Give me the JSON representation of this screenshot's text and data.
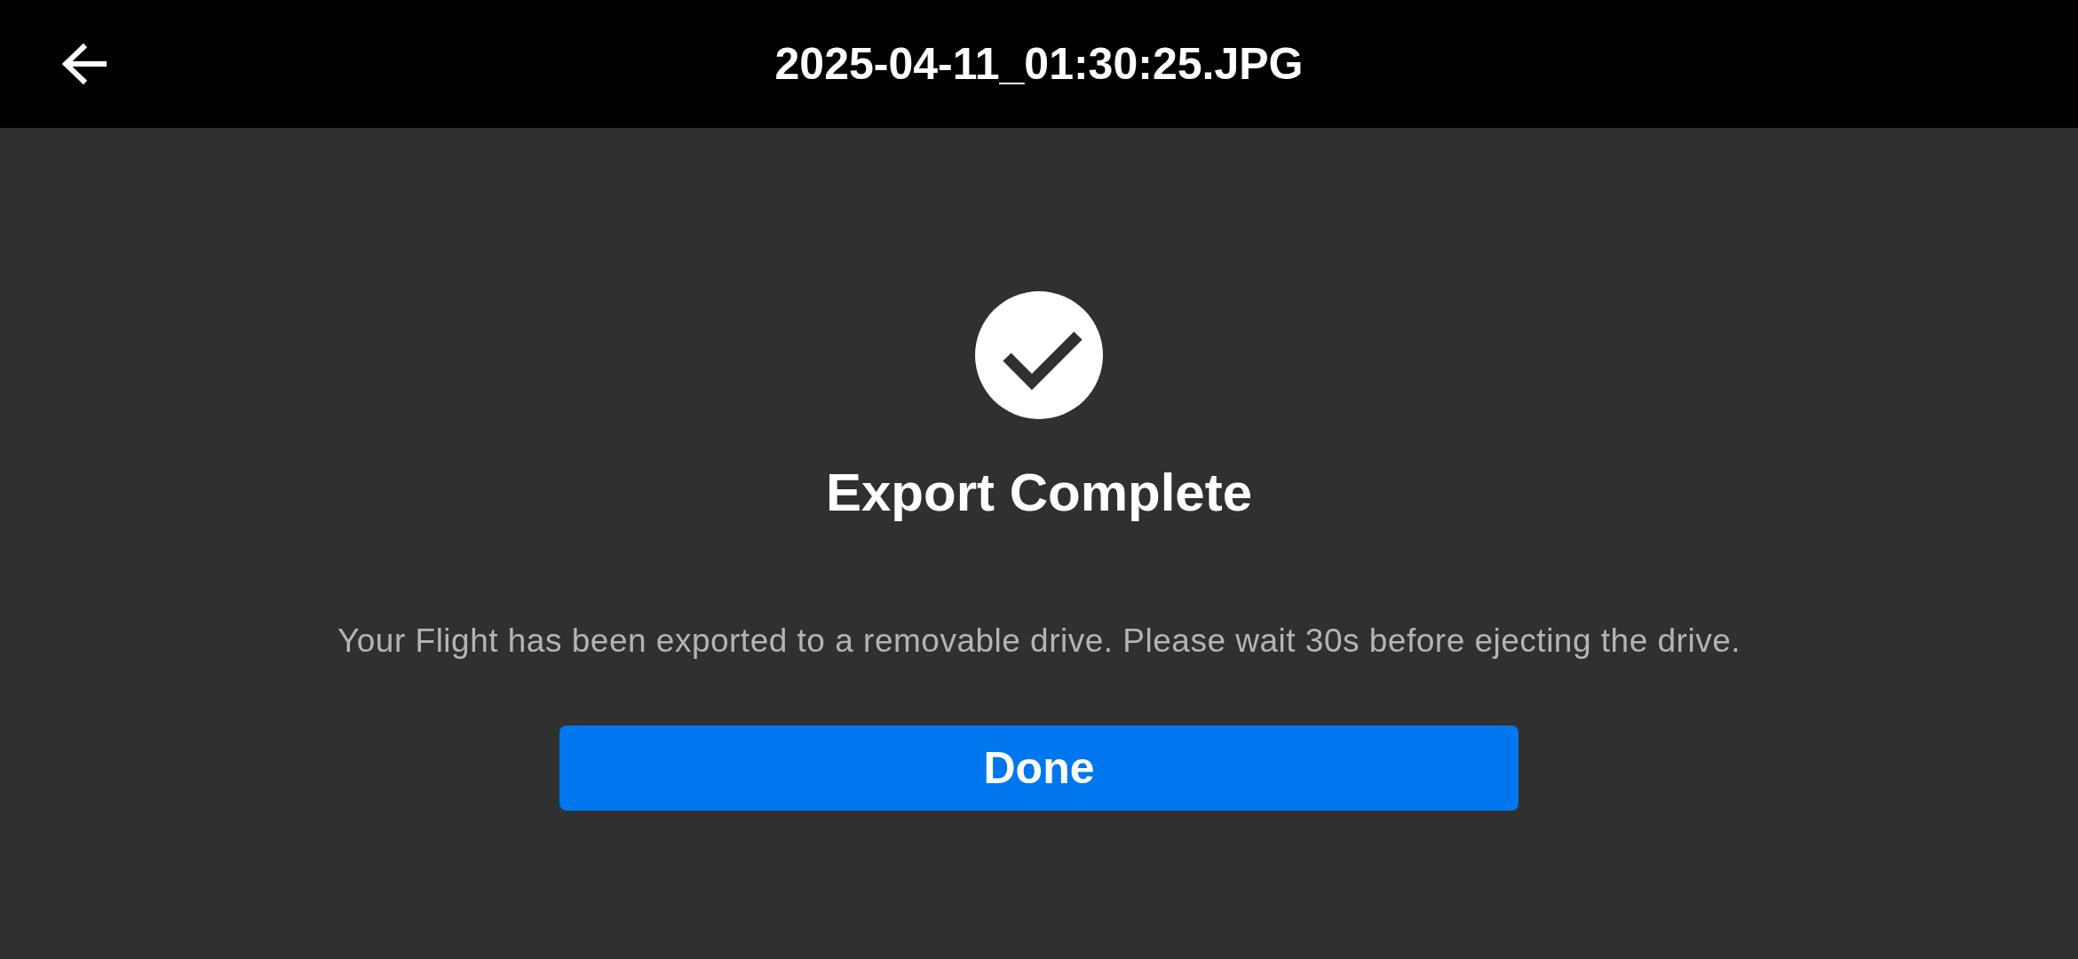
{
  "header": {
    "title": "2025-04-11_01:30:25.JPG"
  },
  "status": {
    "kind": "success",
    "title": "Export Complete",
    "message": "Your Flight has been exported to a removable drive. Please wait 30s before ejecting the drive."
  },
  "buttons": [
    {
      "label": "Done"
    }
  ]
}
